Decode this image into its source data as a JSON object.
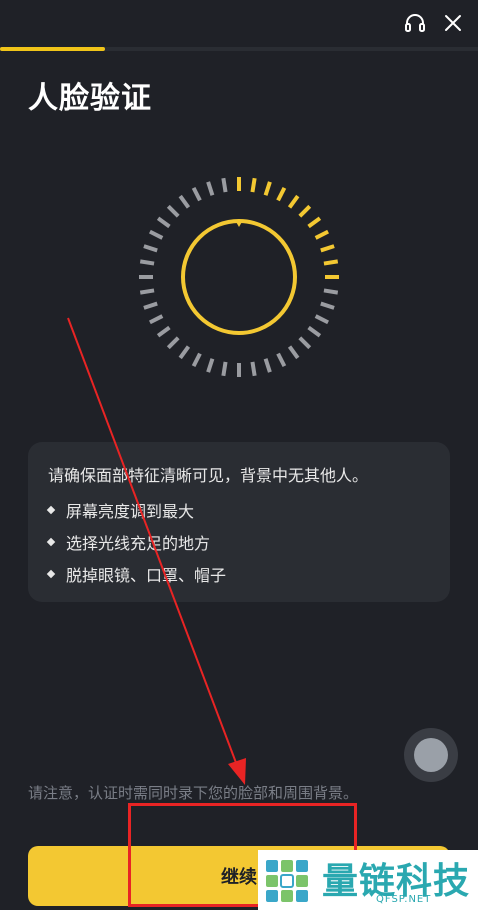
{
  "header": {
    "progress": 0.22
  },
  "page": {
    "title": "人脸验证"
  },
  "info": {
    "main": "请确保面部特征清晰可见，背景中无其他人。",
    "bullets": [
      "屏幕亮度调到最大",
      "选择光线充足的地方",
      "脱掉眼镜、口罩、帽子"
    ]
  },
  "notice": "请注意，认证时需同时录下您的脸部和周围背景。",
  "button": {
    "label": "继续"
  },
  "watermark": {
    "brand": "量链科技",
    "url": "QFSP.NET"
  },
  "colors": {
    "accent": "#f3c832",
    "background": "#1f2127",
    "card": "#2a2d33",
    "annotation": "#e82424"
  },
  "icons": {
    "support": "headset-icon",
    "close": "close-icon"
  }
}
